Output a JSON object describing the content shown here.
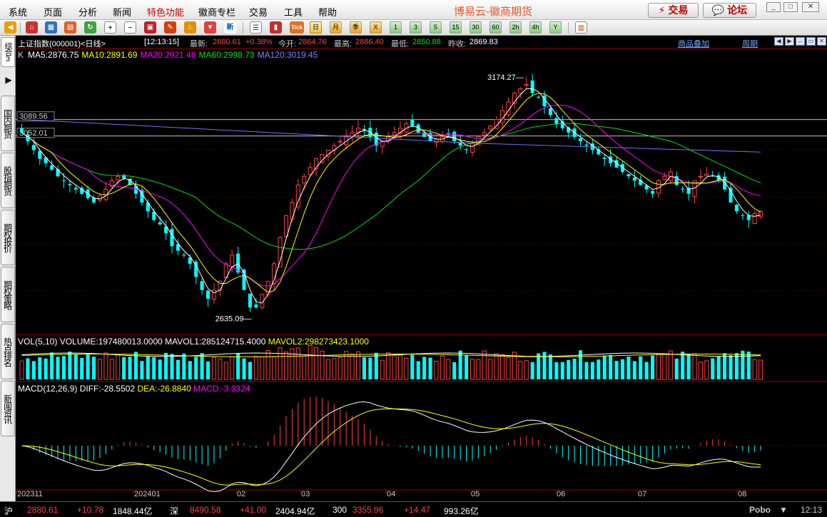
{
  "menu": {
    "items": [
      "系统",
      "页面",
      "分析",
      "新闻",
      "特色功能",
      "徽商专栏",
      "交易",
      "工具",
      "帮助"
    ],
    "title": "博易云-徽商期货",
    "trade_button": "交易",
    "forum_button": "论坛"
  },
  "toolbar": {
    "period_buttons": [
      "日",
      "月",
      "季",
      "X",
      "1",
      "3",
      "5",
      "15",
      "30",
      "60",
      "2h",
      "4h",
      "Y"
    ],
    "tick_label": "Tick"
  },
  "left_tabs": [
    "综合3",
    "国内期货",
    "股指期货",
    "期权报价",
    "期权策略",
    "热点排名",
    "新闻资讯"
  ],
  "info": {
    "name": "上证指数(000001)<日线>",
    "time": "[12:13:15]",
    "latest_label": "最新:",
    "latest": "2880.61",
    "change_pct": "+0.38%",
    "open_label": "今开:",
    "open": "2864.76",
    "high_label": "最高:",
    "high": "2886.40",
    "low_label": "最低:",
    "low": "2850.88",
    "prev_label": "昨收:",
    "prev": "2869.83",
    "overlay_link": "商品叠加",
    "period_link": "周期"
  },
  "ma": {
    "k": "K",
    "ma5": "MA5:2876.75",
    "ma10": "MA10:2891.69",
    "ma20": "MA20:2921.46",
    "ma60": "MA60:2998.73",
    "ma120": "MA120:3019.45"
  },
  "volume_indicator": {
    "name": "VOL(5,10)",
    "volume": "VOLUME:197480013.0000",
    "mavol1": "MAVOL1:285124715.4000",
    "mavol2": "MAVOL2:298273423.1000"
  },
  "macd_indicator": {
    "name": "MACD(12,26,9)",
    "diff": "DIFF:-28.5502",
    "dea": "DEA:-26.8840",
    "macd": "MACD:-3.3324"
  },
  "price_labels": {
    "peak": "3174.27",
    "trough": "2635.09",
    "level1": "3089.56",
    "level2": "3052.01"
  },
  "x_axis": [
    "202311",
    "202401",
    "02",
    "03",
    "04",
    "05",
    "06",
    "07",
    "08"
  ],
  "status": {
    "sh_label": "沪",
    "sh_price": "2880.61",
    "sh_change": "+10.78",
    "sh_amount": "1848.44亿",
    "sz_label": "深",
    "sz_price": "8490.58",
    "sz_change": "+41.00",
    "sz_amount": "2404.94亿",
    "h300_label": "300",
    "h300_price": "3355.96",
    "h300_change": "+14.47",
    "h300_amount": "993.26亿",
    "brand": "Pobo",
    "time": "12:13"
  },
  "colors": {
    "up": "#ff4040",
    "down": "#00ffff",
    "ma5": "#ffffff",
    "ma10": "#ffff00",
    "ma20": "#ff00ff",
    "ma60": "#00e000",
    "ma120": "#7070ff",
    "grid": "#800000"
  },
  "chart_data": {
    "type": "candlestick",
    "title": "上证指数(000001)<日线>",
    "x_range": [
      "2023-11",
      "2024-08"
    ],
    "y_range": [
      2635.09,
      3174.27
    ],
    "closes_approx": [
      3060,
      3040,
      3020,
      3000,
      2990,
      2975,
      2960,
      2950,
      2940,
      2930,
      2920,
      2910,
      2900,
      2915,
      2930,
      2950,
      2960,
      2955,
      2940,
      2920,
      2900,
      2880,
      2860,
      2850,
      2830,
      2800,
      2790,
      2780,
      2760,
      2730,
      2700,
      2680,
      2700,
      2720,
      2760,
      2780,
      2740,
      2700,
      2660,
      2660,
      2690,
      2720,
      2760,
      2820,
      2870,
      2900,
      2940,
      2960,
      2980,
      3000,
      3010,
      3020,
      3030,
      3040,
      3050,
      3060,
      3070,
      3065,
      3050,
      3030,
      3040,
      3050,
      3060,
      3070,
      3080,
      3075,
      3060,
      3050,
      3040,
      3045,
      3050,
      3055,
      3040,
      3030,
      3020,
      3035,
      3050,
      3060,
      3075,
      3090,
      3110,
      3130,
      3150,
      3160,
      3170,
      3150,
      3140,
      3120,
      3100,
      3080,
      3070,
      3060,
      3050,
      3040,
      3030,
      3020,
      3010,
      3000,
      2990,
      2980,
      2970,
      2960,
      2950,
      2940,
      2930,
      2920,
      2950,
      2960,
      2970,
      2940,
      2930,
      2920,
      2950,
      2960,
      2965,
      2960,
      2950,
      2930,
      2900,
      2880,
      2870,
      2860,
      2875,
      2880
    ],
    "ma_values": {
      "MA5": 2876.75,
      "MA10": 2891.69,
      "MA20": 2921.46,
      "MA60": 2998.73,
      "MA120": 3019.45
    },
    "volume": {
      "VOLUME": 197480013.0,
      "MAVOL1": 285124715.4,
      "MAVOL2": 298273423.1
    },
    "macd": {
      "DIFF": -28.5502,
      "DEA": -26.884,
      "MACD": -3.3324
    },
    "annotations": [
      "3174.27",
      "2635.09",
      "3089.56",
      "3052.01"
    ]
  }
}
